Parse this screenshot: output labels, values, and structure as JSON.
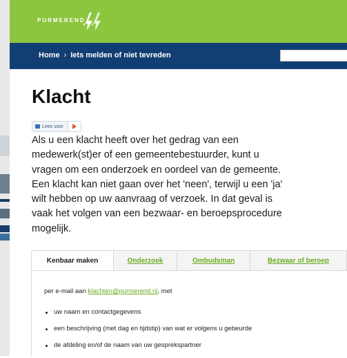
{
  "header": {
    "logo_text": "PURMEREND",
    "brand_color": "#8cc63f",
    "nav_color": "#123f73"
  },
  "breadcrumb": {
    "home": "Home",
    "separator": "›",
    "current": "Iets melden of niet tevreden"
  },
  "search": {
    "placeholder": ""
  },
  "main": {
    "title": "Klacht",
    "readspeaker_label": "Lees voor",
    "intro_lines": [
      "Als u een klacht heeft over het gedrag van een",
      "medewerk(st)er of een gemeentebestuurder, kunt u",
      "vragen om een onderzoek en oordeel van de gemeente.",
      "Een klacht kan niet gaan over het 'neen', terwijl u een 'ja'",
      "wilt hebben op uw aanvraag of verzoek. In dat geval is",
      "vaak het volgen van een bezwaar- en beroepsprocedure",
      "mogelijk."
    ]
  },
  "tabs": [
    {
      "label": "Kenbaar maken",
      "active": true
    },
    {
      "label": "Onderzoek",
      "active": false
    },
    {
      "label": "Ombudsman",
      "active": false
    },
    {
      "label": "Bezwaar of beroep",
      "active": false
    }
  ],
  "panel": {
    "email_prefix": "per e-mail aan ",
    "email": "klachten@purmerend.nl",
    "email_suffix": ", met",
    "bullets": [
      "uw naam en contactgegevens",
      "een beschrijving (met dag en tijdstip) van wat er volgens u gebeurde",
      "de afdeling en/of de naam van uw gesprekspartner"
    ]
  }
}
